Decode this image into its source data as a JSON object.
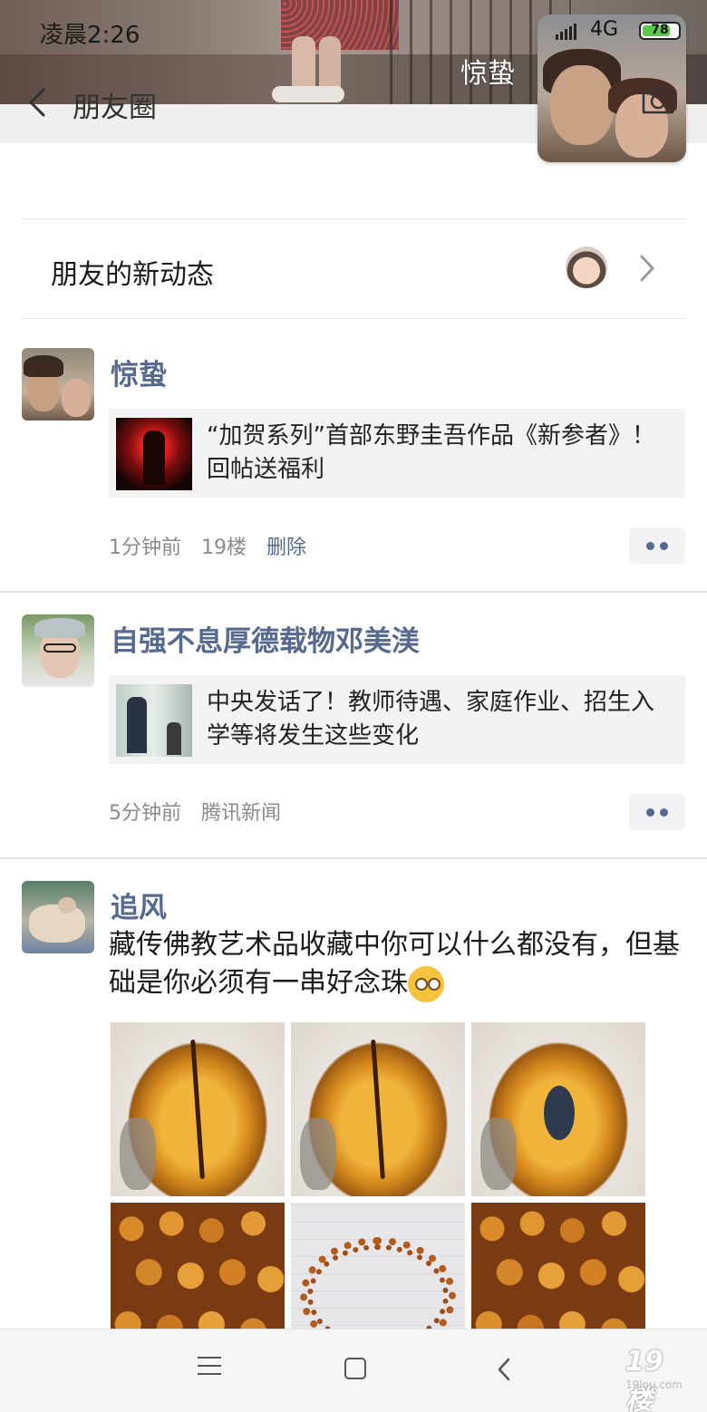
{
  "status_bar": {
    "time": "凌晨2:26",
    "network": "4G",
    "battery": "78",
    "battery_level": 0.78
  },
  "header": {
    "title": "朋友圈",
    "cover_name": "惊蛰"
  },
  "friend_updates": {
    "label": "朋友的新动态"
  },
  "posts": [
    {
      "author": "惊蛰",
      "link_title": "“加贺系列”首部东野圭吾作品《新参者》！回帖送福利",
      "time": "1分钟前",
      "extra": "19楼",
      "action": "删除"
    },
    {
      "author": "自强不息厚德载物邓美渼",
      "link_title": "中央发话了！教师待遇、家庭作业、招生入学等将发生这些变化",
      "time": "5分钟前",
      "extra": "腾讯新闻"
    },
    {
      "author": "追风",
      "text": "藏传佛教艺术品收藏中你可以什么都没有，但基础是你必须有一串好念珠"
    }
  ],
  "watermark": {
    "text": "19楼",
    "sub": "19lou.com"
  },
  "colors": {
    "nickname": "#56698f",
    "meta_gray": "#8a8a8a",
    "card_bg": "#f3f3f5",
    "battery_green": "#5ac94a"
  }
}
